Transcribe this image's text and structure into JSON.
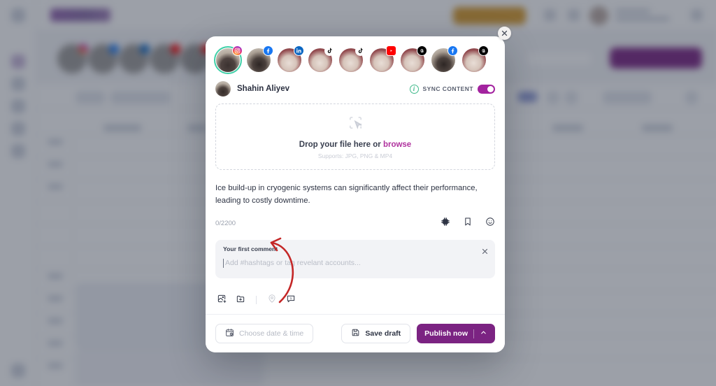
{
  "modal": {
    "close_icon": "close-icon",
    "accounts": [
      {
        "platform": "Instagram",
        "icon": "instagram-icon",
        "selected": true,
        "photo": "a"
      },
      {
        "platform": "Facebook",
        "icon": "facebook-icon",
        "selected": false,
        "photo": "b"
      },
      {
        "platform": "LinkedIn",
        "icon": "linkedin-icon",
        "selected": false,
        "photo": "c"
      },
      {
        "platform": "TikTok",
        "icon": "tiktok-icon",
        "selected": false,
        "photo": "c"
      },
      {
        "platform": "TikTok",
        "icon": "tiktok-icon",
        "selected": false,
        "photo": "c"
      },
      {
        "platform": "YouTube",
        "icon": "youtube-icon",
        "selected": false,
        "photo": "c"
      },
      {
        "platform": "Threads",
        "icon": "threads-icon",
        "selected": false,
        "photo": "c"
      },
      {
        "platform": "Facebook",
        "icon": "facebook-icon",
        "selected": false,
        "photo": "b"
      },
      {
        "platform": "Threads",
        "icon": "threads-icon",
        "selected": false,
        "photo": "c"
      }
    ],
    "user": {
      "name": "Shahin Aliyev",
      "avatar_icon": "avatar"
    },
    "sync": {
      "label": "SYNC CONTENT",
      "info_icon": "info-icon",
      "enabled": true,
      "toggle_color": "#a3239f"
    },
    "dropzone": {
      "icon": "upload-cursor-icon",
      "title_prefix": "Drop your file here or ",
      "browse_label": "browse",
      "supports": "Supports: JPG, PNG & MP4",
      "browse_color": "#b0329e"
    },
    "caption": {
      "text": "Ice build-up in cryogenic systems can significantly affect their performance, leading to costly downtime.",
      "char_count": "0/2200",
      "tools": [
        {
          "name": "ai-chip-icon"
        },
        {
          "name": "bookmark-icon"
        },
        {
          "name": "emoji-icon"
        }
      ]
    },
    "first_comment": {
      "label": "Your first comment",
      "placeholder": "Add #hashtags or tag revelant accounts...",
      "close_icon": "close-icon"
    },
    "comment_tools": [
      {
        "name": "add-image-icon",
        "disabled": false
      },
      {
        "name": "add-folder-icon",
        "disabled": false
      },
      {
        "name": "location-icon",
        "disabled": true
      },
      {
        "name": "first-comment-icon",
        "badge": "1",
        "disabled": false
      }
    ],
    "footer": {
      "date_label": "Choose date & time",
      "date_icon": "calendar-clock-icon",
      "save_draft_label": "Save draft",
      "save_icon": "save-icon",
      "publish_label": "Publish now",
      "publish_chevron_icon": "chevron-up-icon",
      "publish_color": "#7b2382"
    }
  },
  "annotation": {
    "arrow_color": "#c42727",
    "name": "red-curved-arrow"
  }
}
